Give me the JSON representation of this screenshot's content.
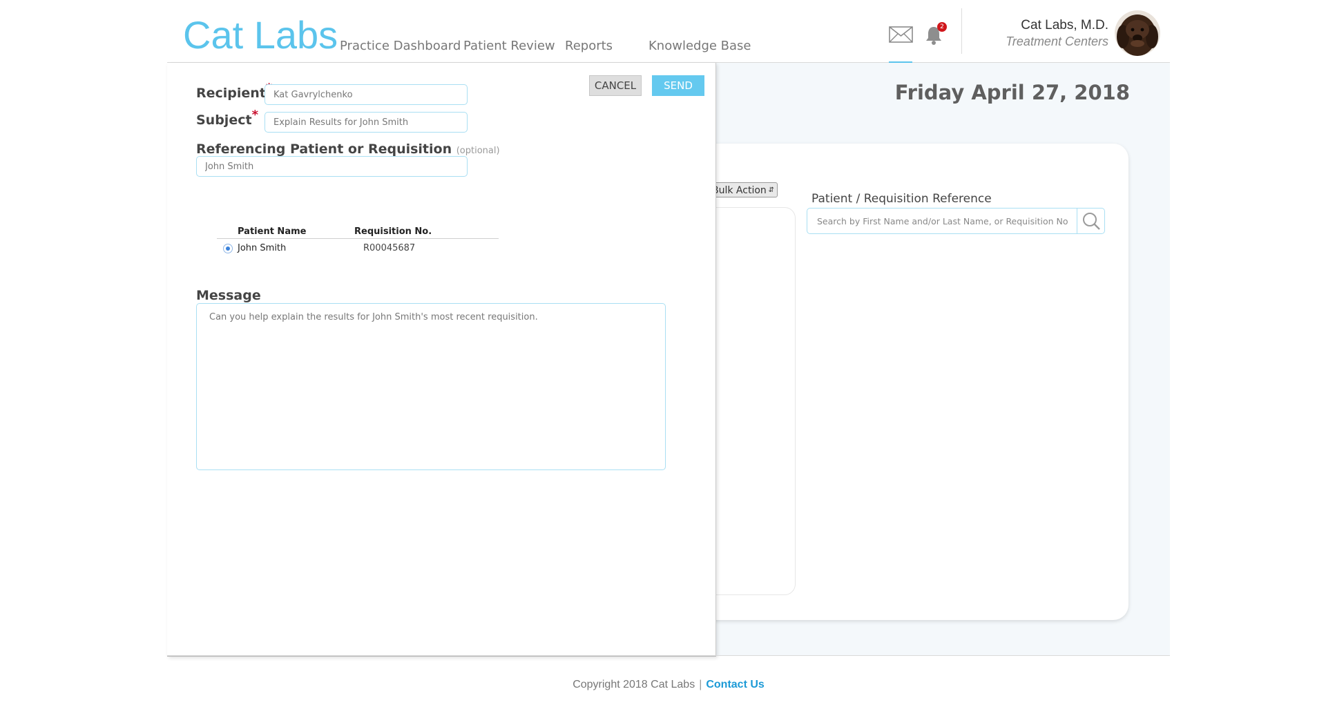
{
  "header": {
    "logo": "Cat Labs",
    "nav": [
      "Practice Dashboard",
      "Patient Review",
      "Reports",
      "Knowledge Base"
    ],
    "notification_count": "2",
    "user_name": "Cat Labs, M.D.",
    "user_org": "Treatment Centers",
    "accent_color": "#5bc4ec",
    "badge_color": "#d0161b"
  },
  "background_page": {
    "date": "Friday April 27, 2018",
    "bulk_action_label": "Bulk Action",
    "reference_label": "Patient / Requisition Reference",
    "reference_placeholder": "Search by First Name and/or Last Name, or Requisition No."
  },
  "compose": {
    "cancel_label": "CANCEL",
    "send_label": "SEND",
    "recipient_label": "Recipient",
    "recipient_value": "Kat Gavrylchenko",
    "subject_label": "Subject",
    "subject_value": "Explain Results for John Smith",
    "required_mark": "*",
    "reference_label": "Referencing Patient or Requisition",
    "reference_optional": "(optional)",
    "reference_value": "John Smith",
    "table": {
      "headers": [
        "Patient Name",
        "Requisition No."
      ],
      "rows": [
        {
          "patient_name": "John Smith",
          "requisition_no": "R00045687",
          "selected": true
        }
      ]
    },
    "message_label": "Message",
    "message_value": "Can you help explain the results for John Smith's most recent requisition."
  },
  "footer": {
    "copyright": "Copyright 2018 Cat Labs",
    "separator": "|",
    "contact": "Contact Us"
  }
}
